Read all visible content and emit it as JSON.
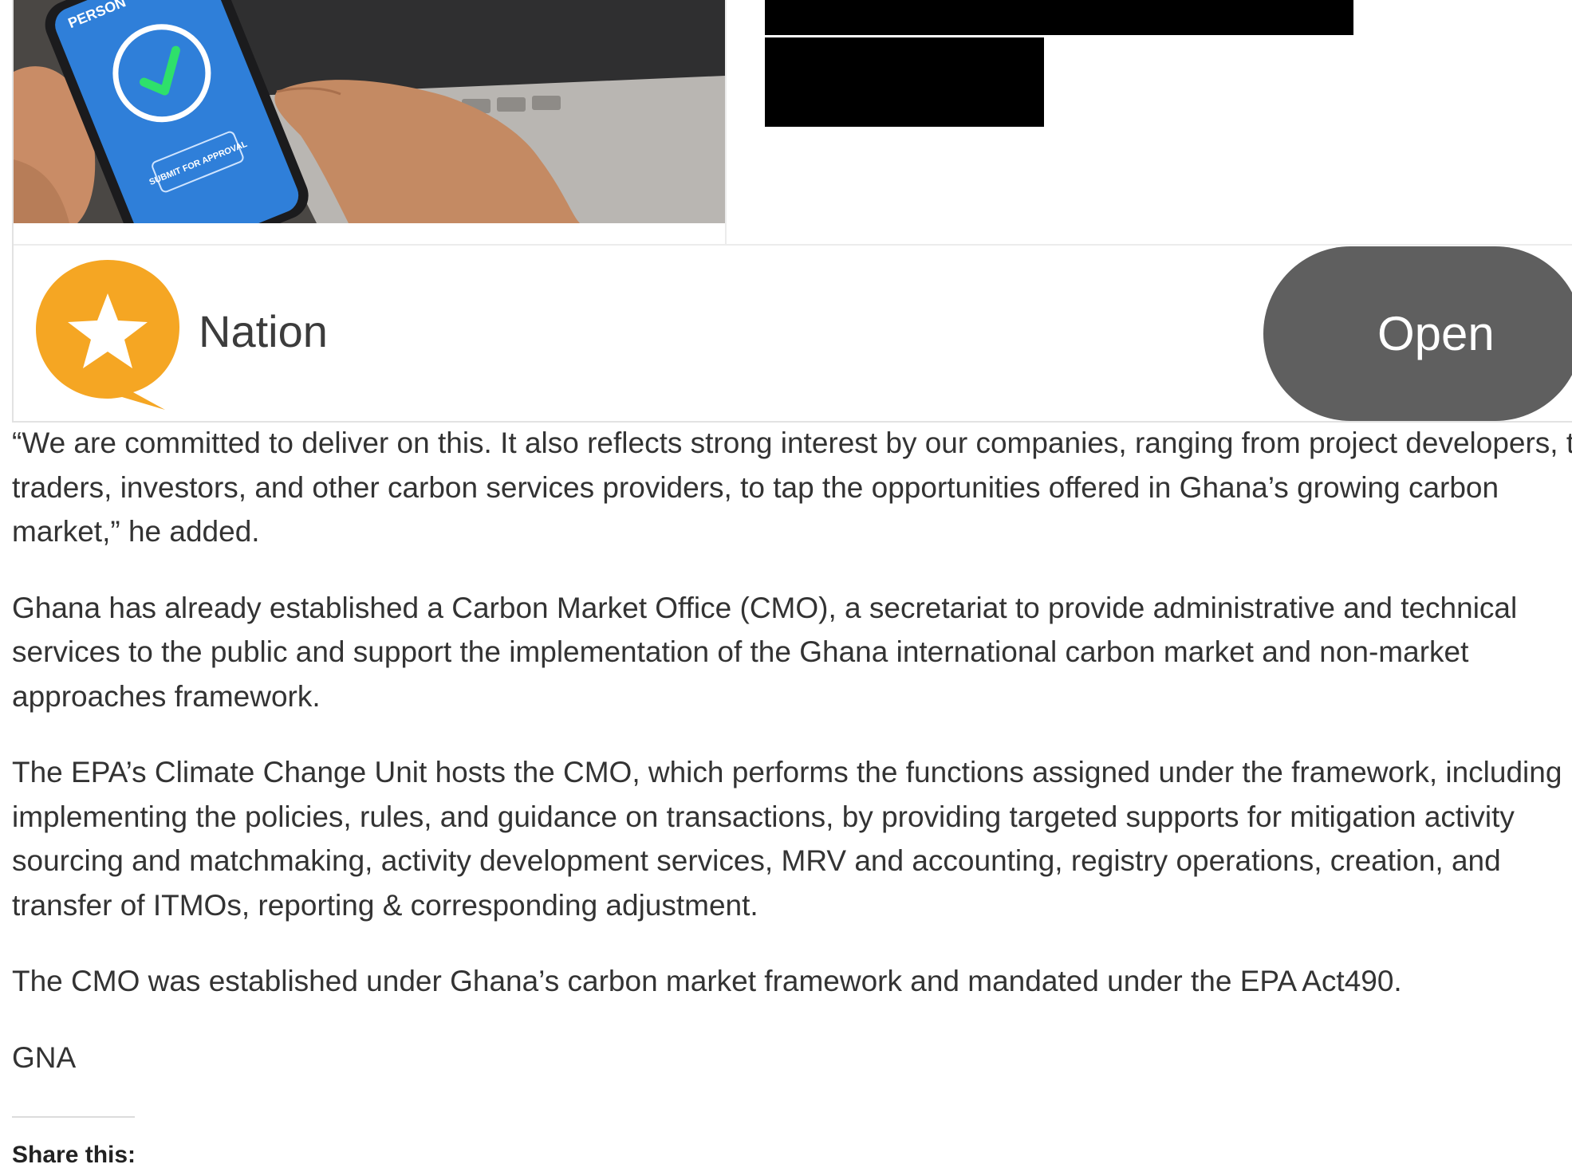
{
  "ad": {
    "image_alt": "Hands holding a smartphone showing a checkmark and a submit for approval button",
    "phone_text_top": "PERSON",
    "phone_button_text": "SUBMIT FOR APPROVAL",
    "brand_name": "Nation",
    "cta_label": "Open",
    "brand_color": "#F5A623",
    "cta_color": "#5F5F5F"
  },
  "article": {
    "paragraphs": [
      "“We are committed to deliver on this. It also reflects strong interest by our companies, ranging from project developers, to traders, investors, and other carbon services providers, to tap the opportunities offered in Ghana’s growing carbon market,” he added.",
      "Ghana has already established a Carbon Market Office (CMO), a secretariat to provide administrative and technical services to the public and support the implementation of the Ghana international carbon market and non-market approaches framework.",
      "The EPA’s Climate Change Unit hosts the CMO, which  performs the functions assigned under the framework, including implementing the policies, rules, and guidance on transactions, by providing targeted supports for mitigation activity sourcing and matchmaking, activity development services, MRV and accounting, registry operations, creation, and transfer of ITMOs, reporting & corresponding adjustment.",
      "The CMO was established under Ghana’s carbon market framework and mandated under the EPA Act490.",
      "GNA"
    ]
  },
  "share": {
    "title": "Share this:"
  }
}
